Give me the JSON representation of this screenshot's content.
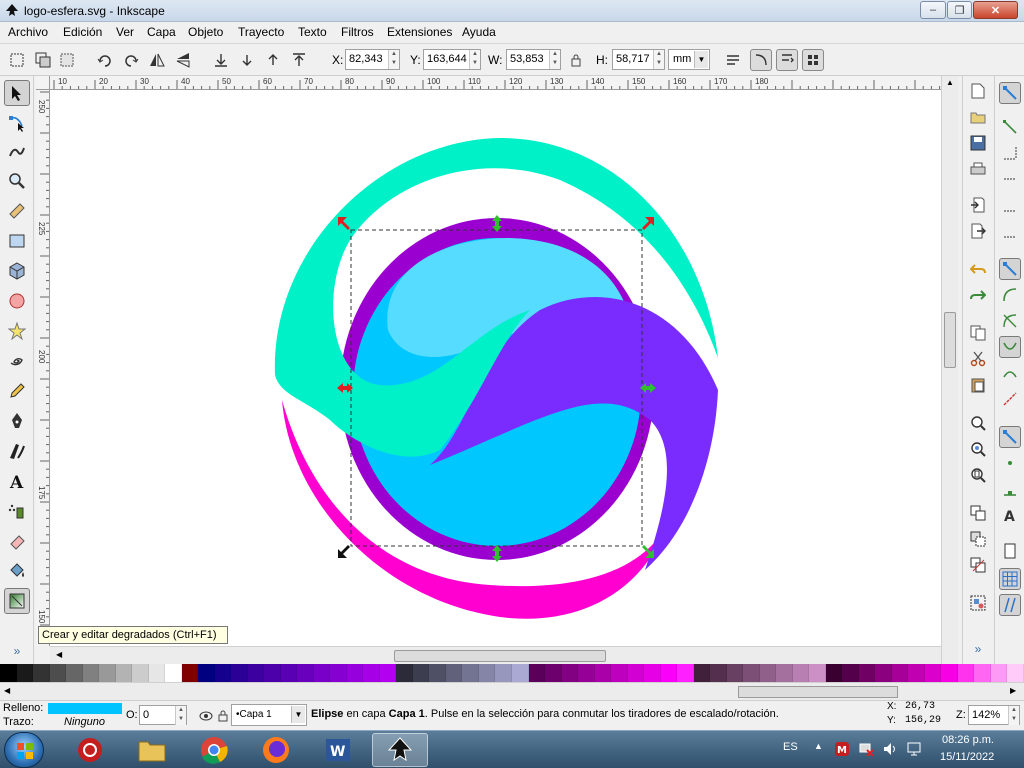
{
  "window": {
    "title": "logo-esfera.svg - Inkscape",
    "minimize_glyph": "–",
    "maximize_glyph": "❐",
    "close_glyph": "✕"
  },
  "menu": [
    {
      "label": "Archivo"
    },
    {
      "label": "Edición"
    },
    {
      "label": "Ver"
    },
    {
      "label": "Capa"
    },
    {
      "label": "Objeto"
    },
    {
      "label": "Trayecto"
    },
    {
      "label": "Texto"
    },
    {
      "label": "Filtros"
    },
    {
      "label": "Extensiones"
    },
    {
      "label": "Ayuda"
    }
  ],
  "controls": {
    "x_label": "X:",
    "x_value": "82,343",
    "y_label": "Y:",
    "y_value": "163,644",
    "w_label": "W:",
    "w_value": "53,853",
    "h_label": "H:",
    "h_value": "58,717",
    "unit": "mm"
  },
  "ruler": {
    "top_ticks": [
      "10",
      "20",
      "30",
      "40",
      "50",
      "60",
      "70",
      "80",
      "90",
      "100",
      "110",
      "120",
      "130",
      "140",
      "150",
      "160",
      "170",
      "180"
    ],
    "left_ticks": [
      "250",
      "225",
      "200",
      "175",
      "150"
    ]
  },
  "colors": {
    "teal": "#00f0c8",
    "purple_ring": "#9a00d0",
    "sphere": "#00c8ff",
    "highlight": "#55dcff",
    "violet": "#7a2cff",
    "magenta": "#ff00d0",
    "fill_swatch": "#00c3ff"
  },
  "tooltip": "Crear y editar degradados (Ctrl+F1)",
  "palette": [
    "#000000",
    "#1a1a1a",
    "#333333",
    "#4d4d4d",
    "#666666",
    "#808080",
    "#999999",
    "#b3b3b3",
    "#cccccc",
    "#e6e6e6",
    "#ffffff",
    "#800000",
    "#000080",
    "#14008c",
    "#2a0096",
    "#3c00a0",
    "#4b00aa",
    "#5a00b4",
    "#6900be",
    "#7800c8",
    "#8700d2",
    "#9600dc",
    "#a500e6",
    "#b400f0",
    "#2b2b3a",
    "#3d3d50",
    "#4f4f66",
    "#61617c",
    "#737392",
    "#8585a8",
    "#9797be",
    "#a9a9d4",
    "#5a005a",
    "#6e006e",
    "#820082",
    "#960096",
    "#aa00aa",
    "#be00be",
    "#d200d2",
    "#e600e6",
    "#fa00fa",
    "#ff20ff",
    "#40203a",
    "#54304e",
    "#684062",
    "#7c5076",
    "#90608a",
    "#a4709e",
    "#b880b2",
    "#cc90c6",
    "#3a0030",
    "#55004a",
    "#700064",
    "#8b007e",
    "#a60098",
    "#c100b2",
    "#dc00cc",
    "#f700e6",
    "#ff33ee",
    "#ff66f2",
    "#ff99f6",
    "#ffccfa"
  ],
  "status": {
    "fill_label": "Relleno:",
    "stroke_label": "Trazo:",
    "stroke_value": "Ninguno",
    "opacity_label": "O:",
    "opacity_value": "0",
    "layer_name": "•Capa 1",
    "message_bold_1": "Elipse",
    "message_part_2": " en capa ",
    "message_bold_2": "Capa 1",
    "message_part_3": ". Pulse en la selección para conmutar los tiradores de escalado/rotación.",
    "cursor_x_label": "X:",
    "cursor_x": "26,73",
    "cursor_y_label": "Y:",
    "cursor_y": "156,29",
    "zoom_label": "Z:",
    "zoom": "142%"
  },
  "taskbar": {
    "language": "ES",
    "time": "08:26 p.m.",
    "date": "15/11/2022"
  }
}
